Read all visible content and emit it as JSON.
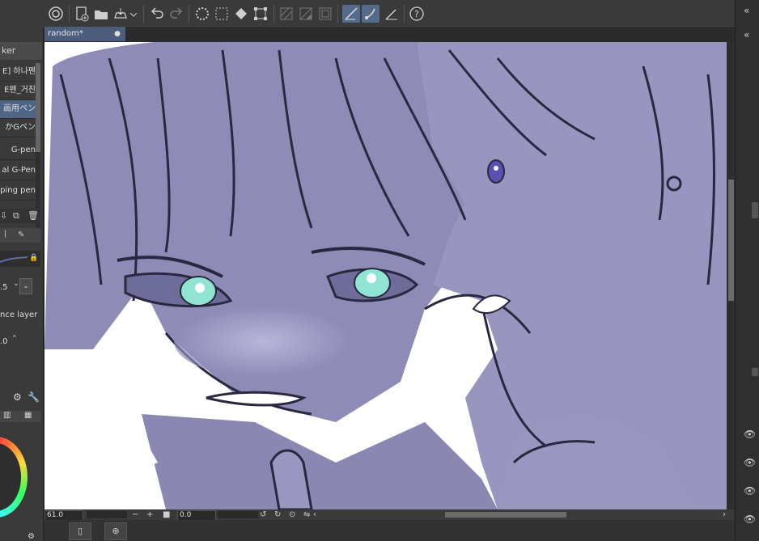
{
  "document": {
    "tab_title": "random*",
    "tab_close": "●"
  },
  "toolbar": {
    "icons": [
      "app-logo-icon",
      "new-icon",
      "open-icon",
      "save-icon",
      "dropdown-icon",
      "undo-icon",
      "redo-icon",
      "busy-icon",
      "select-icon",
      "fill-icon",
      "transform-icon",
      "hatch-icon",
      "hatch2-icon",
      "frame-icon",
      "snap-ruler-icon",
      "snap-brush-icon",
      "snap-line-icon",
      "help-icon"
    ]
  },
  "subtool": {
    "header": "ker",
    "brushes": [
      {
        "label": "E] 하나펜"
      },
      {
        "label": "E펜_거친"
      },
      {
        "label": "画用ペン"
      },
      {
        "label": "かGペン"
      },
      {
        "label": "G-pen"
      },
      {
        "label": "al G-Pen"
      },
      {
        "label": "ping pen"
      }
    ],
    "selected_index": 2,
    "size_value": ".5",
    "reference_label": "nce layer",
    "opacity_value": ".0"
  },
  "status": {
    "zoom": "61.0",
    "minus": "−",
    "plus": "+",
    "angle": "0.0"
  },
  "right_panel": {
    "collapse": "«"
  }
}
